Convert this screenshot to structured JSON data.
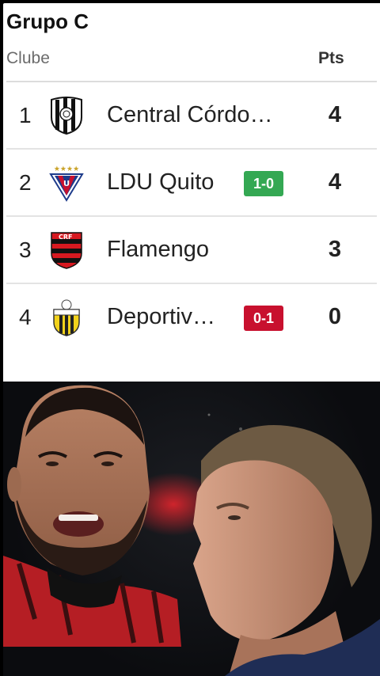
{
  "group": {
    "title": "Grupo C",
    "col_club": "Clube",
    "col_pts": "Pts"
  },
  "rows": [
    {
      "pos": "1",
      "club": "Central Córdo…",
      "pts": "4",
      "badge": "",
      "crest": "central-cordoba-crest-icon"
    },
    {
      "pos": "2",
      "club": "LDU Quito",
      "pts": "4",
      "badge": "1-0",
      "badge_color": "#34a853",
      "crest": "ldu-quito-crest-icon"
    },
    {
      "pos": "3",
      "club": "Flamengo",
      "pts": "3",
      "badge": "",
      "crest": "flamengo-crest-icon"
    },
    {
      "pos": "4",
      "club": "Deportiv…",
      "pts": "0",
      "badge": "0-1",
      "badge_color": "#c8102e",
      "crest": "deportivo-tachira-crest-icon"
    }
  ],
  "colors": {
    "win": "#34a853",
    "loss": "#c8102e",
    "flamengo_red": "#d71920",
    "ldu_blue": "#1d3b8b"
  }
}
